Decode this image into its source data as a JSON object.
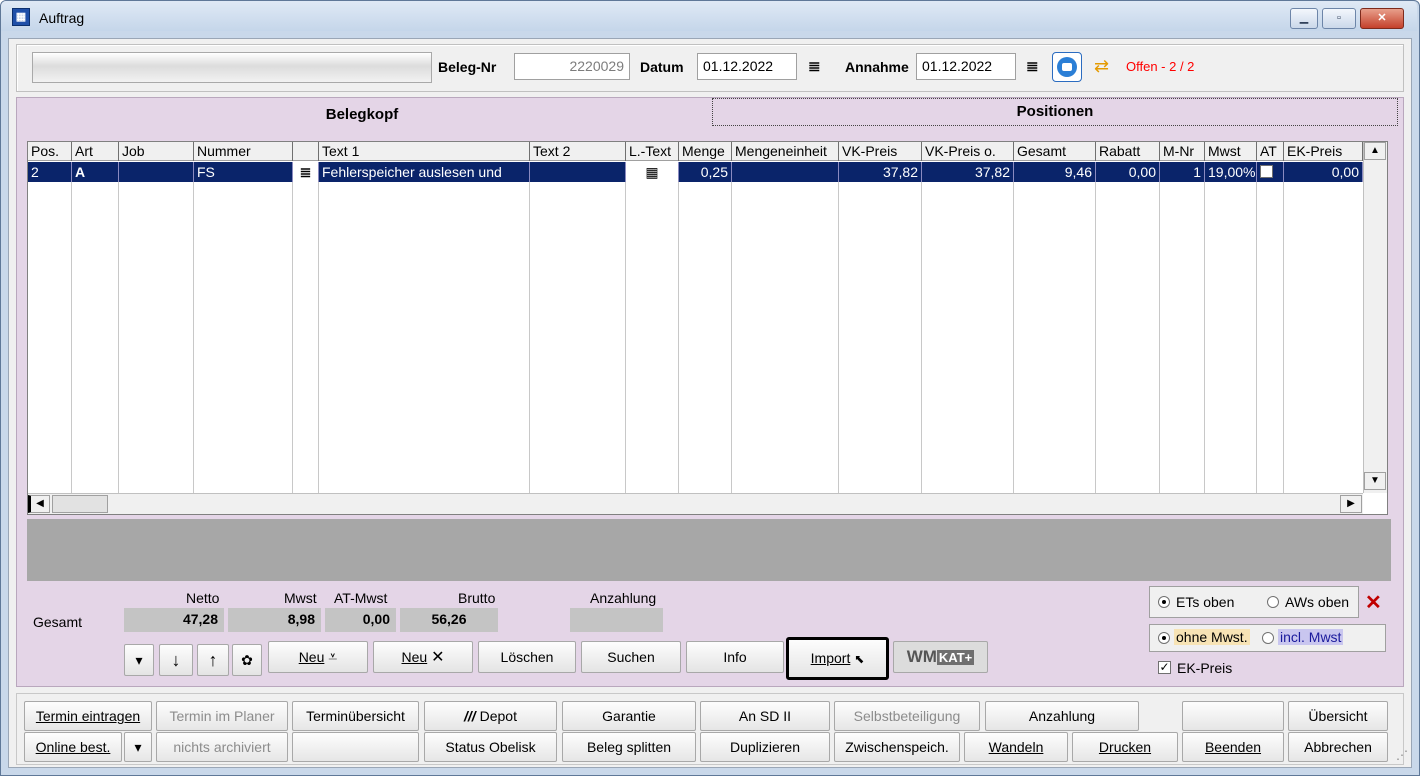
{
  "window": {
    "title": "Auftrag",
    "caption_buttons": [
      "minimize-icon",
      "maximize-icon",
      "close-icon"
    ]
  },
  "header": {
    "beleg_nr_label": "Beleg-Nr",
    "beleg_nr_value": "2220029",
    "datum_label": "Datum",
    "datum_value": "01.12.2022",
    "annahme_label": "Annahme",
    "annahme_value": "01.12.2022",
    "status_text": "Offen - 2 / 2",
    "status_color": "#ff0000"
  },
  "tabs": {
    "belegkopf": "Belegkopf",
    "positionen": "Positionen"
  },
  "grid": {
    "columns": [
      "Pos.",
      "Art",
      "Job",
      "Nummer",
      "",
      "Text 1",
      "Text 2",
      "L.-Text",
      "Menge",
      "Mengeneinheit",
      "VK-Preis",
      "VK-Preis o.",
      "Gesamt",
      "Rabatt",
      "M-Nr",
      "Mwst",
      "AT",
      "EK-Preis"
    ],
    "rows": [
      {
        "pos": "2",
        "art": "A",
        "job": "",
        "nummer": "FS",
        "text1": "Fehlerspeicher auslesen und",
        "text2": "",
        "menge": "0,25",
        "mengeneinheit": "",
        "vk_preis": "37,82",
        "vk_preis_o": "37,82",
        "gesamt": "9,46",
        "rabatt": "0,00",
        "m_nr": "1",
        "mwst": "19,00%",
        "at": false,
        "ek_preis": "0,00"
      }
    ],
    "selection_color": "#0a246a"
  },
  "totals": {
    "row_label": "Gesamt",
    "netto_label": "Netto",
    "netto": "47,28",
    "mwst_label": "Mwst",
    "mwst": "8,98",
    "at_mwst_label": "AT-Mwst",
    "at_mwst": "0,00",
    "brutto_label": "Brutto",
    "brutto": "56,26",
    "anzahlung_label": "Anzahlung",
    "anzahlung": ""
  },
  "actions": {
    "neu1": "Neu",
    "neu2": "Neu",
    "loeschen": "Löschen",
    "suchen": "Suchen",
    "info": "Info",
    "import": "Import",
    "wmkat_wm": "WM",
    "wmkat_kat": "KAT+"
  },
  "options": {
    "ets_oben": "ETs oben",
    "aws_oben": "AWs oben",
    "ohne_mwst": "ohne Mwst.",
    "incl_mwst": "incl. Mwst",
    "ek_preis": "EK-Preis"
  },
  "bottom_row1": [
    "Termin eintragen",
    "Termin im Planer",
    "Terminübersicht",
    "Depot",
    "Garantie",
    "An SD II",
    "Selbstbeteiligung",
    "Anzahlung",
    "",
    "Übersicht"
  ],
  "bottom_row2": [
    "Online best.",
    "nichts archiviert",
    "",
    "Status Obelisk",
    "Beleg splitten",
    "Duplizieren",
    "Zwischenspeich.",
    "Wandeln",
    "Drucken",
    "Beenden",
    "Abbrechen"
  ]
}
